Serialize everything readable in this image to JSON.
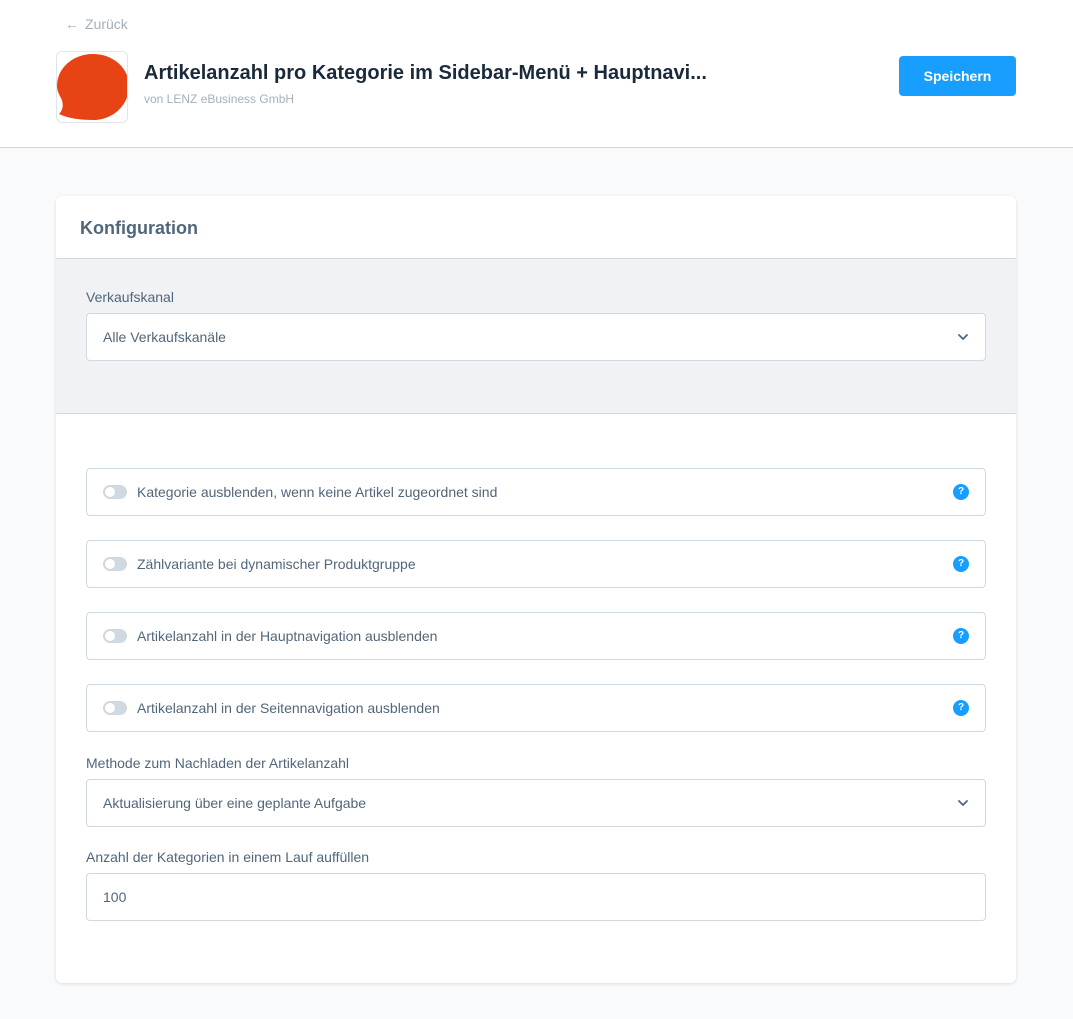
{
  "header": {
    "back_label": "Zurück",
    "back_icon": "arrow-left-icon",
    "app_title": "Artikelanzahl pro Kategorie im Sidebar-Menü + Hauptnavi...",
    "app_vendor": "von LENZ eBusiness GmbH",
    "app_icon_color": "#e84314",
    "save_label": "Speichern"
  },
  "card": {
    "title": "Konfiguration",
    "sales_channel": {
      "label": "Verkaufskanal",
      "value": "Alle Verkaufskanäle"
    },
    "toggles": [
      {
        "label": "Kategorie ausblenden, wenn keine Artikel zugeordnet sind",
        "enabled": false,
        "help": "?"
      },
      {
        "label": "Zählvariante bei dynamischer Produktgruppe",
        "enabled": false,
        "help": "?"
      },
      {
        "label": "Artikelanzahl in der Hauptnavigation ausblenden",
        "enabled": false,
        "help": "?"
      },
      {
        "label": "Artikelanzahl in der Seitennavigation ausblenden",
        "enabled": false,
        "help": "?"
      }
    ],
    "reload_method": {
      "label": "Methode zum Nachladen der Artikelanzahl",
      "value": "Aktualisierung über eine geplante Aufgabe"
    },
    "batch_size": {
      "label": "Anzahl der Kategorien in einem Lauf auffüllen",
      "value": "100"
    }
  },
  "colors": {
    "accent": "#189eff",
    "brand_logo": "#e84314",
    "background": "#f9fafb"
  }
}
